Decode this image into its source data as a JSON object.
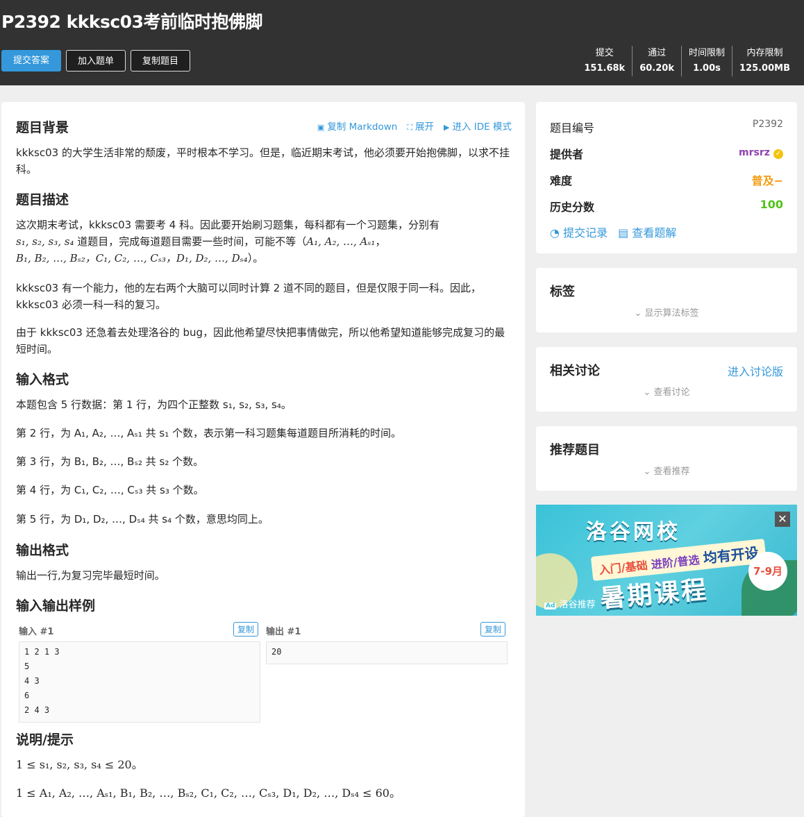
{
  "header": {
    "title": "P2392 kkksc03考前临时抱佛脚",
    "buttons": {
      "submit": "提交答案",
      "add_list": "加入题单",
      "copy": "复制题目"
    },
    "stats": [
      {
        "label": "提交",
        "value": "151.68k"
      },
      {
        "label": "通过",
        "value": "60.20k"
      },
      {
        "label": "时间限制",
        "value": "1.00s"
      },
      {
        "label": "内存限制",
        "value": "125.00MB"
      }
    ]
  },
  "toolbar": {
    "copy_md": "复制 Markdown",
    "expand": "展开",
    "ide": "进入 IDE 模式"
  },
  "sections": {
    "background_title": "题目背景",
    "background_text": "kkksc03 的大学生活非常的颓废，平时根本不学习。但是，临近期末考试，他必须要开始抱佛脚，以求不挂科。",
    "desc_title": "题目描述",
    "desc_p1a": "这次期末考试，kkksc03 需要考 4 科。因此要开始刷习题集，每科都有一个习题集，分别有",
    "desc_p1b": "s₁, s₂, s₃, s₄",
    "desc_p1c": " 道题目，完成每道题目需要一些时间，可能不等（",
    "desc_p1d": "A₁, A₂, …, Aₛ₁",
    "desc_p1e": "，",
    "desc_p1f": "B₁, B₂, …, Bₛ₂，C₁, C₂, …, Cₛ₃，D₁, D₂, …, Dₛ₄",
    "desc_p1g": "）。",
    "desc_p2": "kkksc03 有一个能力，他的左右两个大脑可以同时计算 2 道不同的题目，但是仅限于同一科。因此，kkksc03 必须一科一科的复习。",
    "desc_p3": "由于 kkksc03 还急着去处理洛谷的 bug，因此他希望尽快把事情做完，所以他希望知道能够完成复习的最短时间。",
    "input_title": "输入格式",
    "input_l1": "本题包含 5 行数据：第 1 行，为四个正整数 s₁, s₂, s₃, s₄。",
    "input_l2": "第 2 行，为 A₁, A₂, …, Aₛ₁ 共 s₁ 个数，表示第一科习题集每道题目所消耗的时间。",
    "input_l3": "第 3 行，为 B₁, B₂, …, Bₛ₂ 共 s₂ 个数。",
    "input_l4": "第 4 行，为 C₁, C₂, …, Cₛ₃ 共 s₃ 个数。",
    "input_l5": "第 5 行，为 D₁, D₂, …, Dₛ₄ 共 s₄ 个数，意思均同上。",
    "output_title": "输出格式",
    "output_text": "输出一行,为复习完毕最短时间。",
    "samples_title": "输入输出样例",
    "input_label": "输入 #1",
    "output_label": "输出 #1",
    "copy_label": "复制",
    "sample_in": "1 2 1 3\n5\n4 3\n6\n2 4 3",
    "sample_out": "20",
    "hint_title": "说明/提示",
    "hint_l1": "1 ≤ s₁, s₂, s₃, s₄ ≤ 20。",
    "hint_l2": "1 ≤ A₁, A₂, …, Aₛ₁, B₁, B₂, …, Bₛ₂, C₁, C₂, …, Cₛ₃, D₁, D₂, …, Dₛ₄ ≤ 60。"
  },
  "info": {
    "id_label": "题目编号",
    "id_value": "P2392",
    "provider_label": "提供者",
    "provider_value": "mrsrz",
    "difficulty_label": "难度",
    "difficulty_value": "普及−",
    "score_label": "历史分数",
    "score_value": "100",
    "records": "提交记录",
    "solutions": "查看题解"
  },
  "tags": {
    "title": "标签",
    "toggle": "显示算法标签"
  },
  "discuss": {
    "title": "相关讨论",
    "link": "进入讨论版",
    "toggle": "查看讨论"
  },
  "recommend": {
    "title": "推荐题目",
    "toggle": "查看推荐"
  },
  "ad": {
    "brand": "洛谷网校",
    "line1a": "入门/基础",
    "line1b": "进阶/普选",
    "line1c": "均有开设",
    "badge": "7-9月",
    "main": "暑期课程",
    "tag": "洛谷推荐",
    "ad_mark": "Ad"
  },
  "colors": {
    "accent": "#3498db",
    "provider": "#8e44ad",
    "difficulty": "#f39c11",
    "score": "#52c41a"
  }
}
